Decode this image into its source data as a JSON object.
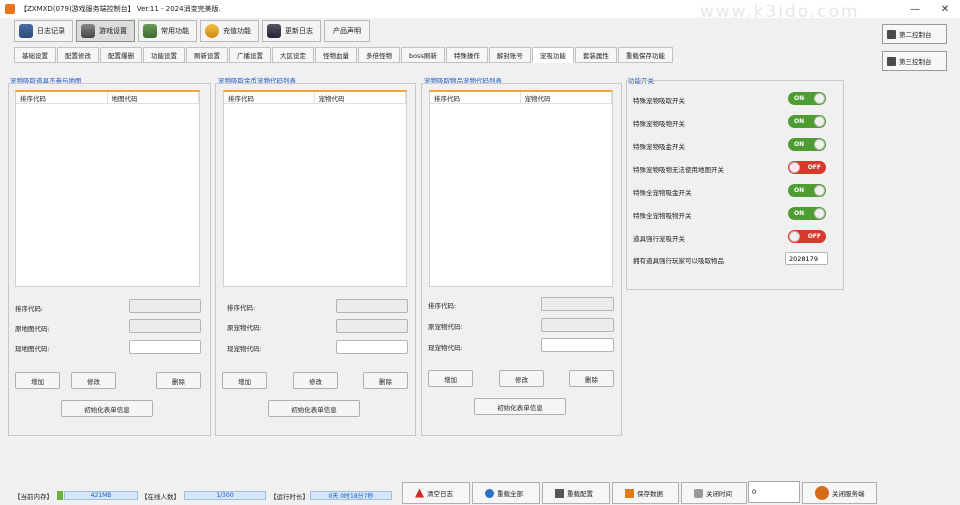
{
  "window": {
    "title": "【ZXMXD(079)游戏服务端控制台】 Ver.11 - 2024消变完美版.",
    "watermark": "www.k3ido.com",
    "minimize": "—",
    "close": "✕"
  },
  "main_tabs": [
    {
      "label": "日志记录"
    },
    {
      "label": "游戏设置"
    },
    {
      "label": "常用功能"
    },
    {
      "label": "充值功能"
    },
    {
      "label": "更新日志"
    },
    {
      "label": "产品声明"
    }
  ],
  "sub_tabs": [
    {
      "label": "基础设置"
    },
    {
      "label": "配置修改"
    },
    {
      "label": "配置爆删"
    },
    {
      "label": "功能设置"
    },
    {
      "label": "刷新设置"
    },
    {
      "label": "广播设置"
    },
    {
      "label": "大区设定"
    },
    {
      "label": "怪物血量"
    },
    {
      "label": "多倍怪物"
    },
    {
      "label": "boss刷新"
    },
    {
      "label": "特殊操作"
    },
    {
      "label": "解封账号"
    },
    {
      "label": "宠吸功能"
    },
    {
      "label": "套装属性"
    },
    {
      "label": "重载保存功能"
    }
  ],
  "side_buttons": [
    {
      "label": "第二控制台"
    },
    {
      "label": "第三控制台"
    }
  ],
  "panels": [
    {
      "title": "宠物吸取道具不参与地图",
      "col1": "排序代码",
      "col2": "地图代码",
      "field1": "排序代码:",
      "field2": "原地图代码:",
      "field3": "现地图代码:",
      "add": "增加",
      "edit": "修改",
      "del": "删除",
      "init": "初始化表单信息"
    },
    {
      "title": "宠物吸取金币宠物代码列表",
      "col1": "排序代码",
      "col2": "宠物代码",
      "field1": "排序代码:",
      "field2": "原宠物代码:",
      "field3": "现宠物代码:",
      "add": "增加",
      "edit": "修改",
      "del": "删除",
      "init": "初始化表单信息"
    },
    {
      "title": "宠物吸取物品宠物代码列表",
      "col1": "排序代码",
      "col2": "宠物代码",
      "field1": "排序代码:",
      "field2": "原宠物代码:",
      "field3": "现宠物代码:",
      "add": "增加",
      "edit": "修改",
      "del": "删除",
      "init": "初始化表单信息"
    }
  ],
  "func_switches": {
    "title": "功能开关",
    "on_text": "ON",
    "off_text": "OFF",
    "items": [
      {
        "label": "特殊宠物吸取开关",
        "state": "on"
      },
      {
        "label": "特殊宠物吸物开关",
        "state": "on"
      },
      {
        "label": "特殊宠物吸金开关",
        "state": "on"
      },
      {
        "label": "特殊宠物吸物无法使用地图开关",
        "state": "off"
      },
      {
        "label": "特殊全宠物吸金开关",
        "state": "on"
      },
      {
        "label": "特殊全宠物吸物开关",
        "state": "on"
      },
      {
        "label": "道具强行宠吸开关",
        "state": "off"
      }
    ],
    "item_label": "拥有道具强行玩家可以吸取物品",
    "item_value": "2028179"
  },
  "status": {
    "memory_label": "【当前内存】",
    "memory_value": "421MB",
    "online_label": "【在线人数】",
    "online_value": "1/300",
    "uptime_label": "【运行时长】",
    "uptime_value": "0天 0时18分7秒"
  },
  "actions": [
    {
      "label": "清空日志"
    },
    {
      "label": "重载全部"
    },
    {
      "label": "重载配置"
    },
    {
      "label": "保存数据"
    },
    {
      "label": "关闭时间"
    },
    {
      "label": "关闭服务端"
    }
  ],
  "close_time_value": "0",
  "colors": {
    "accent_title": "#1d57c9",
    "list_border": "#f4a437",
    "switch_on": "#4e9d32",
    "switch_off": "#d63a2a"
  }
}
